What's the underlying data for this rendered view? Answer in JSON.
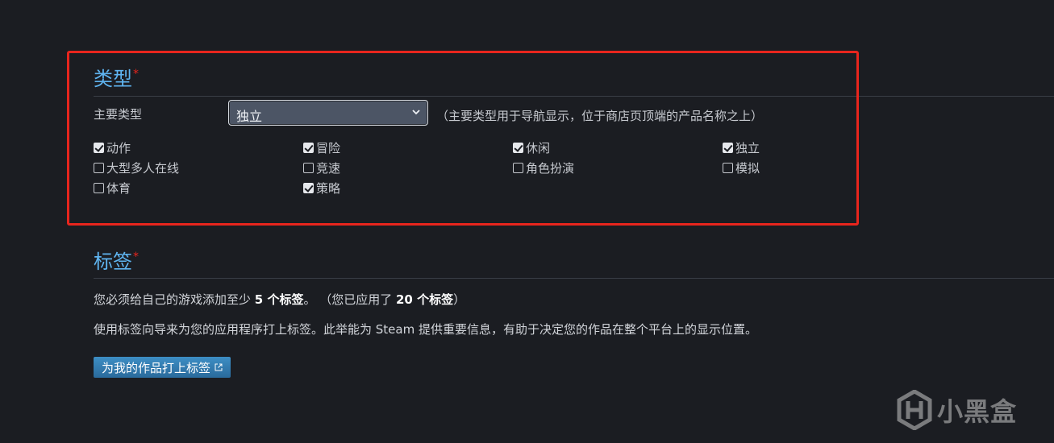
{
  "genre_section": {
    "title": "类型",
    "required_mark": "*",
    "primary_label": "主要类型",
    "primary_select_value": "独立",
    "primary_hint": "（主要类型用于导航显示，位于商店页顶端的产品名称之上）",
    "options": [
      {
        "label": "动作",
        "checked": true
      },
      {
        "label": "冒险",
        "checked": true
      },
      {
        "label": "休闲",
        "checked": true
      },
      {
        "label": "独立",
        "checked": true
      },
      {
        "label": "大型多人在线",
        "checked": false
      },
      {
        "label": "竞速",
        "checked": false
      },
      {
        "label": "角色扮演",
        "checked": false
      },
      {
        "label": "模拟",
        "checked": false
      },
      {
        "label": "体育",
        "checked": false
      },
      {
        "label": "策略",
        "checked": true
      }
    ]
  },
  "tags_section": {
    "title": "标签",
    "required_mark": "*",
    "line1_prefix": "您必须给自己的游戏添加至少 ",
    "line1_min": "5 个标签",
    "line1_mid": "。 （您已应用了 ",
    "line1_applied": "20 个标签",
    "line1_suffix": "）",
    "line2": "使用标签向导来为您的应用程序打上标签。此举能为 Steam 提供重要信息，有助于决定您的作品在整个平台上的显示位置。",
    "button_label": "为我的作品打上标签"
  },
  "watermark": {
    "text": "小黑盒",
    "icon": "heybox-logo-icon"
  },
  "colors": {
    "background": "#1b1d22",
    "accent_title": "#5fb4f0",
    "highlight_border": "#e8251d",
    "button": "#2f79ad"
  }
}
